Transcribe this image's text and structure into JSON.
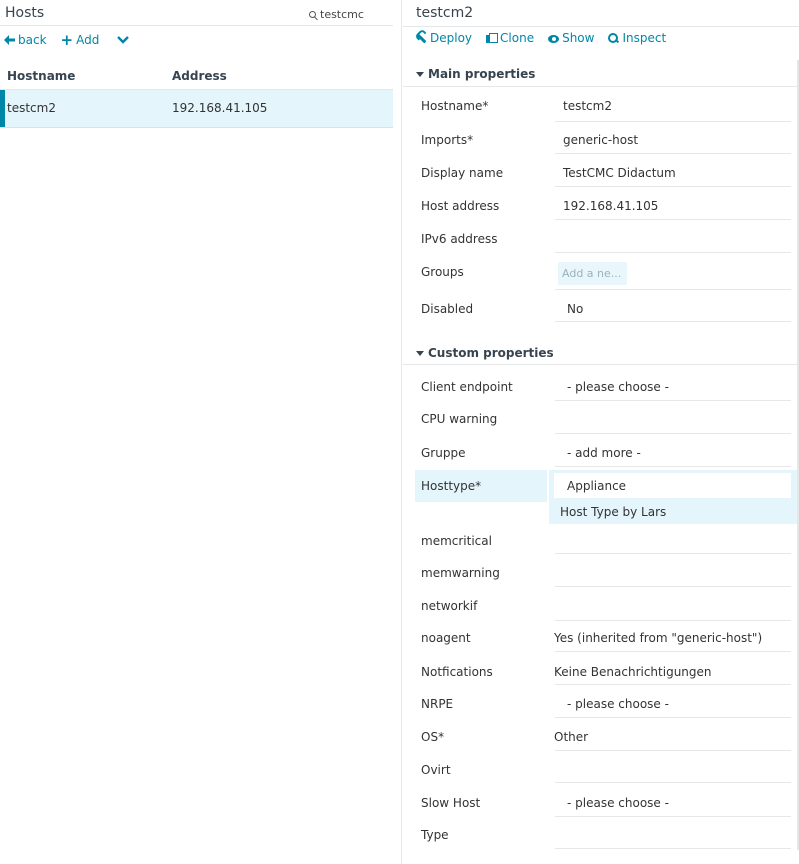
{
  "left": {
    "title": "Hosts",
    "search_value": "testcmc",
    "actions": {
      "back": "back",
      "add": "Add"
    },
    "columns": [
      "Hostname",
      "Address"
    ],
    "rows": [
      {
        "hostname": "testcm2",
        "address": "192.168.41.105"
      }
    ]
  },
  "right": {
    "title": "testcm2",
    "actions": {
      "deploy": "Deploy",
      "clone": "Clone",
      "show": "Show",
      "inspect": "Inspect"
    },
    "main_section": "Main properties",
    "main": {
      "hostname": {
        "label": "Hostname*",
        "value": "testcm2"
      },
      "imports": {
        "label": "Imports*",
        "value": "generic-host"
      },
      "display_name": {
        "label": "Display name",
        "value": "TestCMC Didactum"
      },
      "host_address": {
        "label": "Host address",
        "value": "192.168.41.105"
      },
      "ipv6": {
        "label": "IPv6 address",
        "value": ""
      },
      "groups": {
        "label": "Groups",
        "placeholder": "Add a ne..."
      },
      "disabled": {
        "label": "Disabled",
        "value": "No"
      }
    },
    "custom_section": "Custom properties",
    "custom": {
      "client_endpoint": {
        "label": "Client endpoint",
        "value": "- please choose -"
      },
      "cpu_warning": {
        "label": "CPU warning",
        "value": ""
      },
      "gruppe": {
        "label": "Gruppe",
        "value": "- add more -"
      },
      "hosttype": {
        "label": "Hosttype*",
        "value": "Appliance",
        "description": "Host Type by Lars"
      },
      "memcritical": {
        "label": "memcritical",
        "value": ""
      },
      "memwarning": {
        "label": "memwarning",
        "value": ""
      },
      "networkif": {
        "label": "networkif",
        "value": ""
      },
      "noagent": {
        "label": "noagent",
        "value": "Yes (inherited from \"generic-host\")"
      },
      "notfications": {
        "label": "Notfications",
        "value": "Keine Benachrichtigungen"
      },
      "nrpe": {
        "label": "NRPE",
        "value": "- please choose -"
      },
      "os": {
        "label": "OS*",
        "value": "Other"
      },
      "ovirt": {
        "label": "Ovirt",
        "value": ""
      },
      "slow_host": {
        "label": "Slow Host",
        "value": "- please choose -"
      },
      "type": {
        "label": "Type",
        "value": ""
      }
    }
  },
  "colors": {
    "accent": "#0087a8",
    "selected_row": "#e4f5fb",
    "border": "#e4e8ea"
  }
}
